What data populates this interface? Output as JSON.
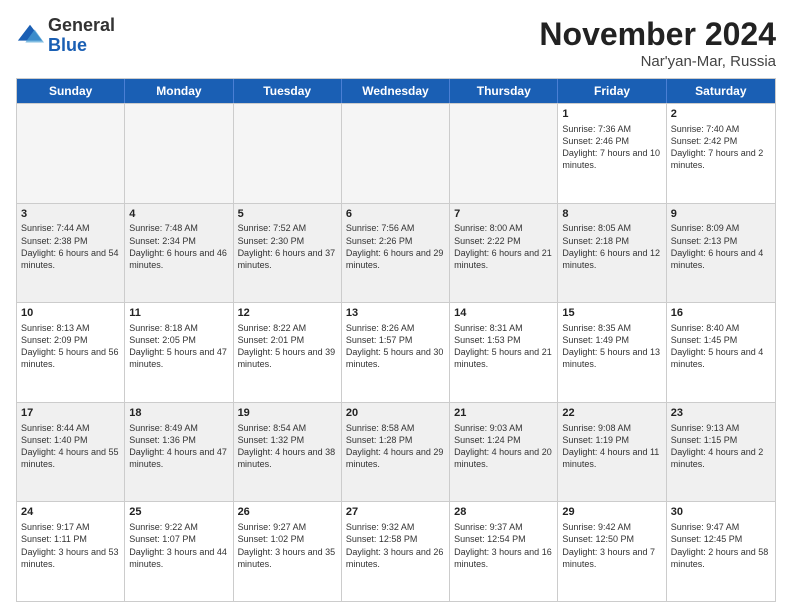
{
  "logo": {
    "line1": "General",
    "line2": "Blue"
  },
  "title": "November 2024",
  "location": "Nar'yan-Mar, Russia",
  "days_of_week": [
    "Sunday",
    "Monday",
    "Tuesday",
    "Wednesday",
    "Thursday",
    "Friday",
    "Saturday"
  ],
  "weeks": [
    [
      {
        "day": "",
        "empty": true
      },
      {
        "day": "",
        "empty": true
      },
      {
        "day": "",
        "empty": true
      },
      {
        "day": "",
        "empty": true
      },
      {
        "day": "",
        "empty": true
      },
      {
        "day": "1",
        "sunrise": "Sunrise: 7:36 AM",
        "sunset": "Sunset: 2:46 PM",
        "daylight": "Daylight: 7 hours and 10 minutes."
      },
      {
        "day": "2",
        "sunrise": "Sunrise: 7:40 AM",
        "sunset": "Sunset: 2:42 PM",
        "daylight": "Daylight: 7 hours and 2 minutes."
      }
    ],
    [
      {
        "day": "3",
        "sunrise": "Sunrise: 7:44 AM",
        "sunset": "Sunset: 2:38 PM",
        "daylight": "Daylight: 6 hours and 54 minutes."
      },
      {
        "day": "4",
        "sunrise": "Sunrise: 7:48 AM",
        "sunset": "Sunset: 2:34 PM",
        "daylight": "Daylight: 6 hours and 46 minutes."
      },
      {
        "day": "5",
        "sunrise": "Sunrise: 7:52 AM",
        "sunset": "Sunset: 2:30 PM",
        "daylight": "Daylight: 6 hours and 37 minutes."
      },
      {
        "day": "6",
        "sunrise": "Sunrise: 7:56 AM",
        "sunset": "Sunset: 2:26 PM",
        "daylight": "Daylight: 6 hours and 29 minutes."
      },
      {
        "day": "7",
        "sunrise": "Sunrise: 8:00 AM",
        "sunset": "Sunset: 2:22 PM",
        "daylight": "Daylight: 6 hours and 21 minutes."
      },
      {
        "day": "8",
        "sunrise": "Sunrise: 8:05 AM",
        "sunset": "Sunset: 2:18 PM",
        "daylight": "Daylight: 6 hours and 12 minutes."
      },
      {
        "day": "9",
        "sunrise": "Sunrise: 8:09 AM",
        "sunset": "Sunset: 2:13 PM",
        "daylight": "Daylight: 6 hours and 4 minutes."
      }
    ],
    [
      {
        "day": "10",
        "sunrise": "Sunrise: 8:13 AM",
        "sunset": "Sunset: 2:09 PM",
        "daylight": "Daylight: 5 hours and 56 minutes."
      },
      {
        "day": "11",
        "sunrise": "Sunrise: 8:18 AM",
        "sunset": "Sunset: 2:05 PM",
        "daylight": "Daylight: 5 hours and 47 minutes."
      },
      {
        "day": "12",
        "sunrise": "Sunrise: 8:22 AM",
        "sunset": "Sunset: 2:01 PM",
        "daylight": "Daylight: 5 hours and 39 minutes."
      },
      {
        "day": "13",
        "sunrise": "Sunrise: 8:26 AM",
        "sunset": "Sunset: 1:57 PM",
        "daylight": "Daylight: 5 hours and 30 minutes."
      },
      {
        "day": "14",
        "sunrise": "Sunrise: 8:31 AM",
        "sunset": "Sunset: 1:53 PM",
        "daylight": "Daylight: 5 hours and 21 minutes."
      },
      {
        "day": "15",
        "sunrise": "Sunrise: 8:35 AM",
        "sunset": "Sunset: 1:49 PM",
        "daylight": "Daylight: 5 hours and 13 minutes."
      },
      {
        "day": "16",
        "sunrise": "Sunrise: 8:40 AM",
        "sunset": "Sunset: 1:45 PM",
        "daylight": "Daylight: 5 hours and 4 minutes."
      }
    ],
    [
      {
        "day": "17",
        "sunrise": "Sunrise: 8:44 AM",
        "sunset": "Sunset: 1:40 PM",
        "daylight": "Daylight: 4 hours and 55 minutes."
      },
      {
        "day": "18",
        "sunrise": "Sunrise: 8:49 AM",
        "sunset": "Sunset: 1:36 PM",
        "daylight": "Daylight: 4 hours and 47 minutes."
      },
      {
        "day": "19",
        "sunrise": "Sunrise: 8:54 AM",
        "sunset": "Sunset: 1:32 PM",
        "daylight": "Daylight: 4 hours and 38 minutes."
      },
      {
        "day": "20",
        "sunrise": "Sunrise: 8:58 AM",
        "sunset": "Sunset: 1:28 PM",
        "daylight": "Daylight: 4 hours and 29 minutes."
      },
      {
        "day": "21",
        "sunrise": "Sunrise: 9:03 AM",
        "sunset": "Sunset: 1:24 PM",
        "daylight": "Daylight: 4 hours and 20 minutes."
      },
      {
        "day": "22",
        "sunrise": "Sunrise: 9:08 AM",
        "sunset": "Sunset: 1:19 PM",
        "daylight": "Daylight: 4 hours and 11 minutes."
      },
      {
        "day": "23",
        "sunrise": "Sunrise: 9:13 AM",
        "sunset": "Sunset: 1:15 PM",
        "daylight": "Daylight: 4 hours and 2 minutes."
      }
    ],
    [
      {
        "day": "24",
        "sunrise": "Sunrise: 9:17 AM",
        "sunset": "Sunset: 1:11 PM",
        "daylight": "Daylight: 3 hours and 53 minutes."
      },
      {
        "day": "25",
        "sunrise": "Sunrise: 9:22 AM",
        "sunset": "Sunset: 1:07 PM",
        "daylight": "Daylight: 3 hours and 44 minutes."
      },
      {
        "day": "26",
        "sunrise": "Sunrise: 9:27 AM",
        "sunset": "Sunset: 1:02 PM",
        "daylight": "Daylight: 3 hours and 35 minutes."
      },
      {
        "day": "27",
        "sunrise": "Sunrise: 9:32 AM",
        "sunset": "Sunset: 12:58 PM",
        "daylight": "Daylight: 3 hours and 26 minutes."
      },
      {
        "day": "28",
        "sunrise": "Sunrise: 9:37 AM",
        "sunset": "Sunset: 12:54 PM",
        "daylight": "Daylight: 3 hours and 16 minutes."
      },
      {
        "day": "29",
        "sunrise": "Sunrise: 9:42 AM",
        "sunset": "Sunset: 12:50 PM",
        "daylight": "Daylight: 3 hours and 7 minutes."
      },
      {
        "day": "30",
        "sunrise": "Sunrise: 9:47 AM",
        "sunset": "Sunset: 12:45 PM",
        "daylight": "Daylight: 2 hours and 58 minutes."
      }
    ]
  ]
}
